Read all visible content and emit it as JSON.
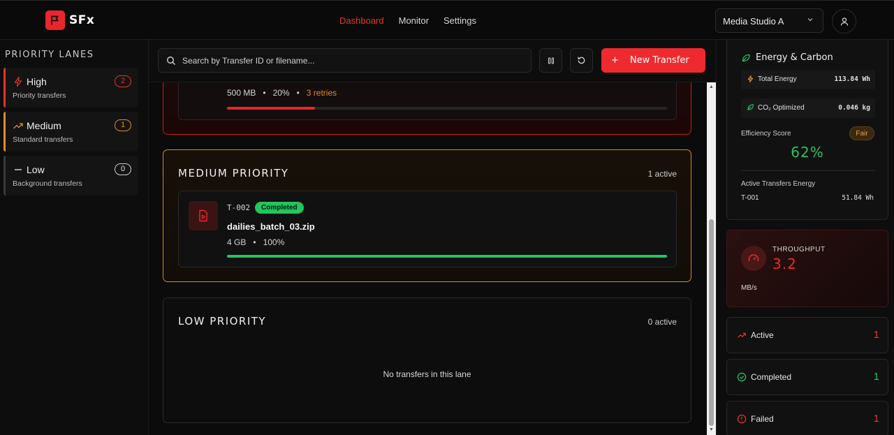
{
  "brand": {
    "name": "SFx",
    "color": "#e8262c"
  },
  "nav": {
    "items": [
      "Dashboard",
      "Monitor",
      "Settings"
    ],
    "active": "Dashboard"
  },
  "workspace": {
    "selected": "Media Studio A"
  },
  "sidebar": {
    "title": "PRIORITY LANES",
    "lanes": [
      {
        "name": "High",
        "subtitle": "Priority transfers",
        "count": "2",
        "color": "#e8332f",
        "icon": "lightning-icon"
      },
      {
        "name": "Medium",
        "subtitle": "Standard transfers",
        "count": "1",
        "color": "#e28a2c",
        "icon": "trending-up-icon"
      },
      {
        "name": "Low",
        "subtitle": "Background transfers",
        "count": "0",
        "color": "#cfcfcf",
        "icon": "minus-icon"
      }
    ]
  },
  "toolbar": {
    "search_placeholder": "Search by Transfer ID or filename...",
    "new_transfer_label": "New Transfer",
    "plus": "+"
  },
  "lanes_main": {
    "high": {
      "visible_card": {
        "size": "500 MB",
        "progress_text": "20%",
        "retries": "3 retries",
        "progress": 0.2,
        "color": "#e8262c"
      }
    },
    "medium": {
      "title": "MEDIUM PRIORITY",
      "active": "1 active",
      "card": {
        "id": "T-002",
        "status": "Completed",
        "filename": "dailies_batch_03.zip",
        "size": "4 GB",
        "progress_text": "100%",
        "progress": 1.0,
        "color": "#22c55e"
      }
    },
    "low": {
      "title": "LOW PRIORITY",
      "active": "0 active",
      "empty_text": "No transfers in this lane"
    },
    "separator": "•"
  },
  "energy": {
    "title": "Energy & Carbon",
    "total_energy_label": "Total Energy",
    "total_energy_value": "113.84 Wh",
    "co2_label": "CO₂ Optimized",
    "co2_value": "0.046 kg",
    "efficiency_label": "Efficiency Score",
    "efficiency_badge": "Fair",
    "efficiency_value": "62%",
    "active_energy_label": "Active Transfers Energy",
    "active_rows": [
      {
        "id": "T-001",
        "value": "51.84 Wh"
      }
    ]
  },
  "throughput": {
    "label": "THROUGHPUT",
    "value": "3.2",
    "unit": "MB/s"
  },
  "stats": [
    {
      "label": "Active",
      "value": "1",
      "color": "#e8332f",
      "icon": "trending-up-icon"
    },
    {
      "label": "Completed",
      "value": "1",
      "color": "#22c55e",
      "icon": "check-circle-icon"
    },
    {
      "label": "Failed",
      "value": "1",
      "color": "#e8332f",
      "icon": "alert-circle-icon"
    }
  ]
}
